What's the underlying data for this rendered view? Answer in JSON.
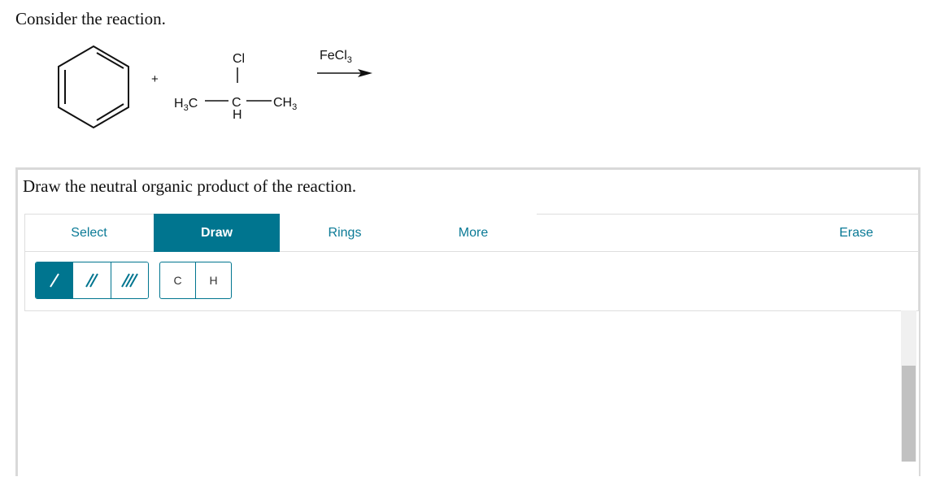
{
  "question": {
    "prompt": "Consider the reaction.",
    "task": "Draw the neutral organic product of the reaction."
  },
  "reaction": {
    "plus": "+",
    "reagent": {
      "top_atom": "Cl",
      "bottom_atom": "H",
      "center_atom": "C"
    },
    "catalyst": "FeCl",
    "catalyst_subscript": "3"
  },
  "toolbar": {
    "tabs": [
      {
        "label": "Select"
      },
      {
        "label": "Draw"
      },
      {
        "label": "Rings"
      },
      {
        "label": "More"
      },
      {
        "label": "Erase"
      }
    ],
    "active_tab": "Draw",
    "accent_color": "#00758f"
  },
  "subtools": {
    "bonds": [
      "single-bond",
      "double-bond",
      "triple-bond"
    ],
    "atoms": [
      {
        "label": "C"
      },
      {
        "label": "H"
      }
    ]
  }
}
